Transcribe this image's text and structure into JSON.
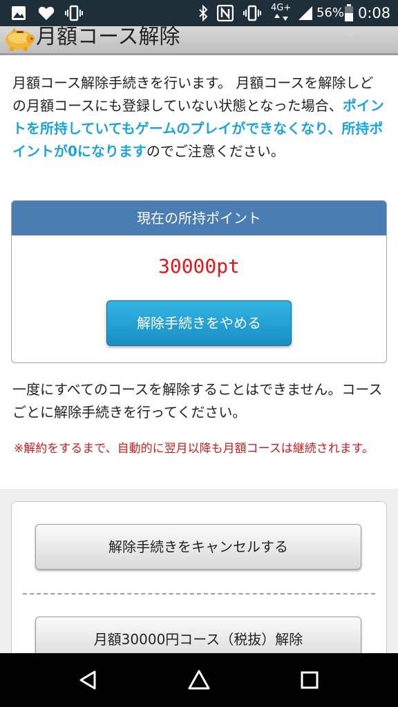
{
  "statusbar": {
    "network": "4G+",
    "battery_percent": "56%",
    "time": "0:08"
  },
  "header": {
    "title": "月額コース解除"
  },
  "intro": {
    "text_1": "月額コース解除手続きを行います。 月額コースを解除しどの月額コースにも登録していない状態となった場合、",
    "highlight": "ポイントを所持していてもゲームのプレイができなくなり、所持ポイントが0になります",
    "text_2": "のでご注意ください。"
  },
  "points_card": {
    "header": "現在の所持ポイント",
    "points": "30000pt",
    "stop_button": "解除手続きをやめる"
  },
  "note": "一度にすべてのコースを解除することはできません。コースごとに解除手続きを行ってください。",
  "warning": "※解約をするまで、自動的に翌月以降も月額コースは継続されます。",
  "actions": {
    "cancel_button": "解除手続きをキャンセルする",
    "course_button": "月額30000円コース（税抜）解除"
  },
  "colors": {
    "header_blue": "#4a7eb2",
    "accent_blue": "#1aa3dd",
    "points_red": "#e01616",
    "warning_red": "#c81f1f"
  }
}
